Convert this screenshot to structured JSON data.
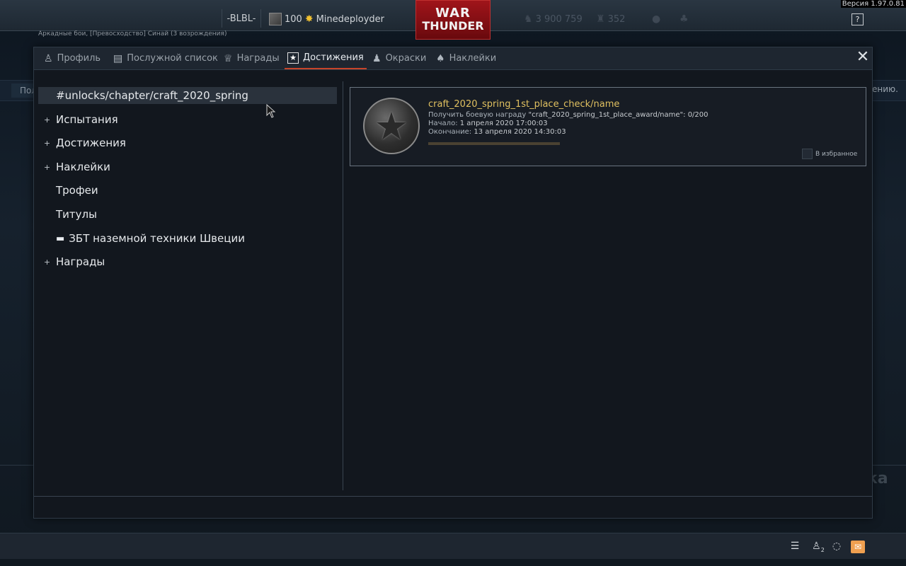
{
  "app": {
    "version": "Версия 1.97.0.81",
    "mode_line": "Аркадные бои, [Превосходство] Синай (3 возрождения)"
  },
  "topbar": {
    "squad_label": "-BLBL-",
    "player_level": "100",
    "player_name": "Minedeployder",
    "logo_line1": "WAR",
    "logo_line2": "THUNDER",
    "silver_lions": "3 900 759",
    "golden_eagles": "352",
    "help_label": "?"
  },
  "tabs": [
    {
      "label": "Профиль",
      "icon": "profile-icon"
    },
    {
      "label": "Послужной список",
      "icon": "service-record-icon"
    },
    {
      "label": "Награды",
      "icon": "medal-icon"
    },
    {
      "label": "Достижения",
      "icon": "achievement-star-icon",
      "active": true
    },
    {
      "label": "Окраски",
      "icon": "paint-brush-icon"
    },
    {
      "label": "Наклейки",
      "icon": "decal-icon"
    }
  ],
  "left_list": [
    {
      "label": "#unlocks/chapter/craft_2020_spring",
      "expandable": false,
      "selected": true
    },
    {
      "label": "Испытания",
      "expandable": true,
      "expander": "+"
    },
    {
      "label": "Достижения",
      "expandable": true,
      "expander": "+"
    },
    {
      "label": "Наклейки",
      "expandable": true,
      "expander": "+"
    },
    {
      "label": "Трофеи",
      "expandable": false
    },
    {
      "label": "Титулы",
      "expandable": false
    },
    {
      "label": "ЗБТ наземной техники Швеции",
      "expandable": false,
      "icon": "tank-icon"
    },
    {
      "label": "Награды",
      "expandable": true,
      "expander": "+"
    }
  ],
  "card": {
    "title": "craft_2020_spring_1st_place_check/name",
    "line1_key": "Получить боевую награду",
    "line1_value": "\"craft_2020_spring_1st_place_award/name\": 0/200",
    "line2_key": "Начало:",
    "line2_value": "1 апреля 2020 17:00:03",
    "line3_key": "Окончание:",
    "line3_value": "13 апреля 2020 14:30:03",
    "progress": 0,
    "favorite_label": "В избранное",
    "favorite_checked": false
  },
  "background": {
    "peek_left": "Пол",
    "peek_right": "ению.",
    "loading": "Загрузка"
  },
  "bottombar": {
    "list_icon": "list-icon",
    "friends_count": "2",
    "chat_icon": "chat-icon",
    "mail_icon": "mail-icon"
  },
  "colors": {
    "accent_tab": "#c8442a",
    "card_title": "#e0c060",
    "logo_red": "#a0141a",
    "mail_orange": "#f0a050"
  }
}
